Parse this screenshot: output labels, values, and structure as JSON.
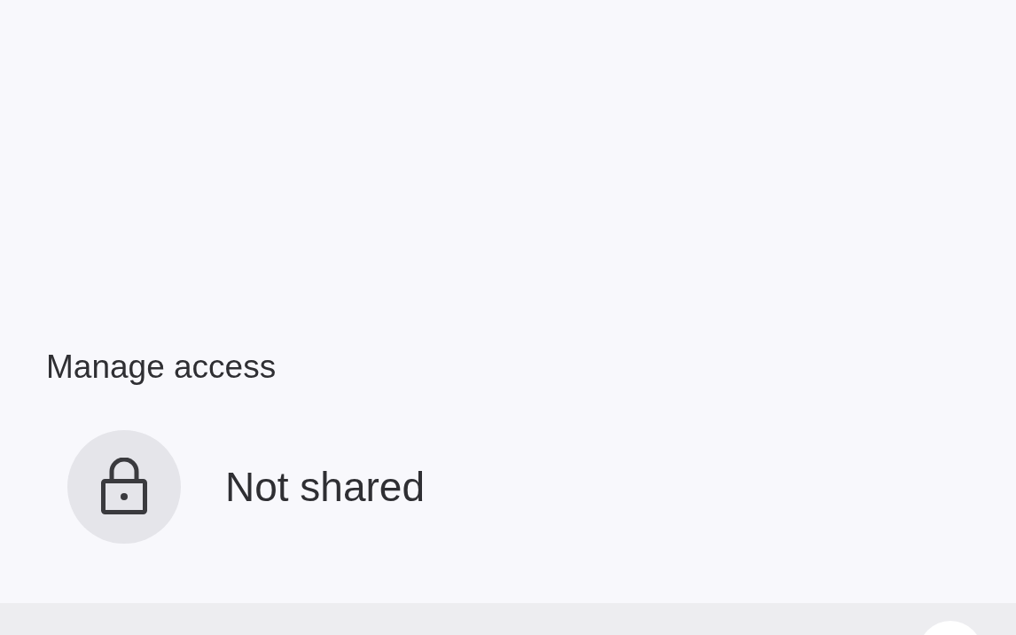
{
  "section": {
    "title": "Manage access"
  },
  "access": {
    "label": "Not shared"
  }
}
